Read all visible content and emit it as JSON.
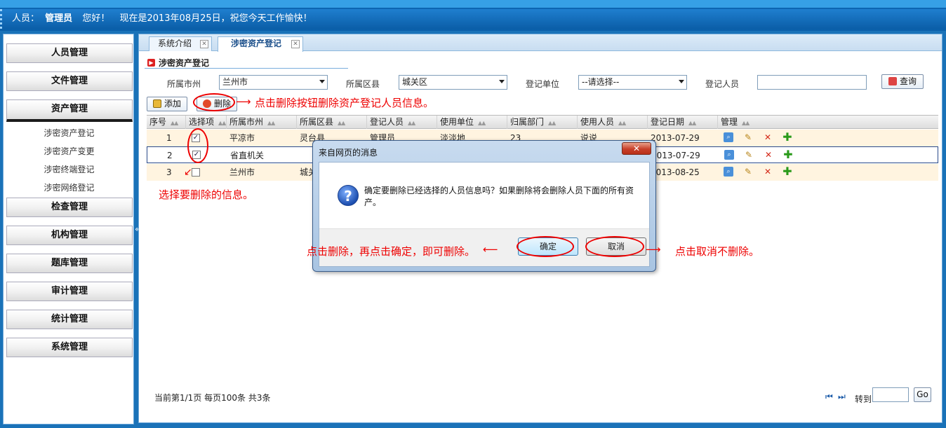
{
  "header": {
    "user_prefix": "人员：",
    "user_name": "管理员",
    "greeting": "您好！",
    "date_message": "现在是2013年08月25日，祝您今天工作愉快！"
  },
  "sidebar": {
    "menus": [
      {
        "label": "人员管理"
      },
      {
        "label": "文件管理"
      },
      {
        "label": "资产管理",
        "active": true
      },
      {
        "label": "检查管理"
      },
      {
        "label": "机构管理"
      },
      {
        "label": "题库管理"
      },
      {
        "label": "审计管理"
      },
      {
        "label": "统计管理"
      },
      {
        "label": "系统管理"
      }
    ],
    "sub_items": [
      "涉密资产登记",
      "涉密资产变更",
      "涉密终端登记",
      "涉密网络登记"
    ],
    "collapse_glyph": "«"
  },
  "tabs": [
    {
      "label": "系统介绍",
      "active": false
    },
    {
      "label": "涉密资产登记",
      "active": true
    }
  ],
  "panel": {
    "title": "涉密资产登记",
    "filters": {
      "city_label": "所属市州",
      "city_value": "兰州市",
      "county_label": "所属区县",
      "county_value": "城关区",
      "unit_label": "登记单位",
      "unit_value": "--请选择--",
      "person_label": "登记人员",
      "person_value": "",
      "search_label": "查询"
    },
    "toolbar": {
      "add_label": "添加",
      "delete_label": "删除"
    }
  },
  "table": {
    "columns": [
      "序号",
      "选择项",
      "所属市州",
      "所属区县",
      "登记人员",
      "使用单位",
      "归属部门",
      "使用人员",
      "登记日期",
      "管理"
    ],
    "rows": [
      {
        "no": "1",
        "checked": true,
        "city": "平凉市",
        "county": "灵台县",
        "person": "管理员",
        "unit": "淡淡地",
        "dept": "23",
        "user": "说说",
        "date": "2013-07-29"
      },
      {
        "no": "2",
        "checked": true,
        "city": "省直机关",
        "county": "",
        "person": "",
        "unit": "",
        "dept": "",
        "user": "",
        "date": "2013-07-29"
      },
      {
        "no": "3",
        "checked": false,
        "city": "兰州市",
        "county": "城关",
        "person": "",
        "unit": "",
        "dept": "",
        "user": "",
        "date": "2013-08-25"
      }
    ]
  },
  "footer": {
    "info": "当前第1/1页  每页100条  共3条",
    "goto_label": "转到",
    "go_label": "Go",
    "first_glyph": "⏮",
    "next_glyph": "⏭"
  },
  "annotations": {
    "delete_hint": "点击删除按钮删除资产登记人员信息。",
    "select_hint": "选择要删除的信息。",
    "confirm_hint": "点击删除，再点击确定，即可删除。",
    "cancel_hint": "点击取消不删除。"
  },
  "dialog": {
    "title": "来自网页的消息",
    "close_glyph": "✕",
    "message": "确定要删除已经选择的人员信息吗？如果删除将会删除人员下面的所有资产。",
    "ok_label": "确定",
    "cancel_label": "取消"
  },
  "colors": {
    "accent": "#0b5ea8",
    "annotation": "#ee0000",
    "row_highlight": "#fff4e0"
  }
}
